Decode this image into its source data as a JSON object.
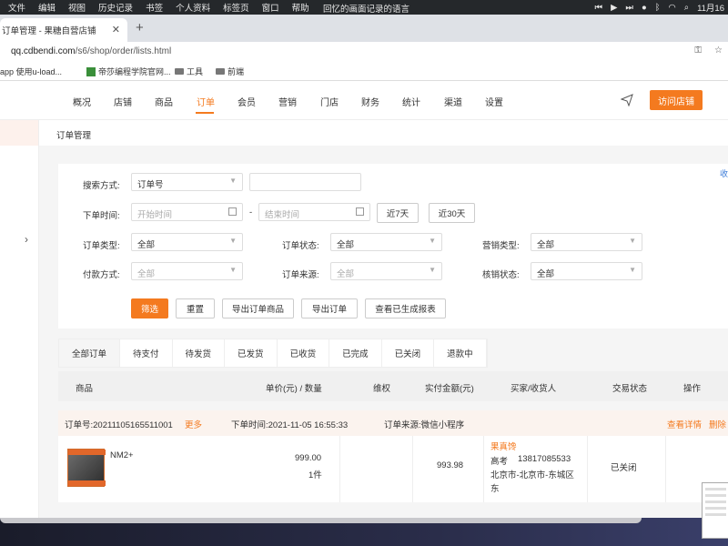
{
  "menubar": {
    "items": [
      "文件",
      "编辑",
      "视图",
      "历史记录",
      "书签",
      "个人资料",
      "标签页",
      "窗口",
      "帮助"
    ],
    "center_text": "回忆的画面记录的语言",
    "clock": "11月16"
  },
  "browser": {
    "tab_title": "订单管理 - 果糖自营店铺",
    "url_host": "qq.cdbendi.com",
    "url_path": "/s6/shop/order/lists.html",
    "bookmarks": [
      {
        "label": "app 使用u-load...",
        "icon": "app-icon"
      },
      {
        "label": "帝莎编程学院官网...",
        "icon": "site-icon"
      },
      {
        "label": "工具",
        "icon": "folder-icon"
      },
      {
        "label": "前端",
        "icon": "folder-icon"
      }
    ]
  },
  "topnav": {
    "items": [
      "概况",
      "店铺",
      "商品",
      "订单",
      "会员",
      "营销",
      "门店",
      "财务",
      "统计",
      "渠道",
      "设置"
    ],
    "active": "订单",
    "visit_button": "访问店铺"
  },
  "breadcrumb": "订单管理",
  "filters": {
    "collapse_link": "收",
    "search_label": "搜索方式:",
    "search_type": "订单号",
    "search_value": "",
    "time_label": "下单时间:",
    "start_placeholder": "开始时间",
    "end_placeholder": "结束时间",
    "dash": "-",
    "quick_7": "近7天",
    "quick_30": "近30天",
    "order_type_label": "订单类型:",
    "order_type": "全部",
    "order_status_label": "订单状态:",
    "order_status": "全部",
    "marketing_label": "营销类型:",
    "marketing": "全部",
    "pay_label": "付款方式:",
    "pay": "全部",
    "source_label": "订单来源:",
    "source": "全部",
    "verify_label": "核销状态:",
    "verify": "全部",
    "btn_filter": "筛选",
    "btn_reset": "重置",
    "btn_export_goods": "导出订单商品",
    "btn_export_orders": "导出订单",
    "btn_reports": "查看已生成报表"
  },
  "order_tabs": [
    "全部订单",
    "待支付",
    "待发货",
    "已发货",
    "已收货",
    "已完成",
    "已关闭",
    "退款中"
  ],
  "table_headers": [
    "商品",
    "单价(元) / 数量",
    "维权",
    "实付金额(元)",
    "买家/收货人",
    "交易状态",
    "操作"
  ],
  "order": {
    "order_no_label": "订单号:",
    "order_no": "20211105165511001",
    "more": "更多",
    "time_label": "下单时间:",
    "time": "2021-11-05 16:55:33",
    "source_label": "订单来源:",
    "source": "微信小程序",
    "view_detail": "查看详情",
    "delete": "删除",
    "product_name": "NM2+",
    "price": "999.00",
    "qty": "1件",
    "paid": "993.98",
    "buyer": "果真馋",
    "receiver_name": "高考",
    "receiver_phone": "13817085533",
    "address_line1": "北京市-北京市-东城区",
    "address_line2": "东",
    "status": "已关闭"
  },
  "colors": {
    "accent": "#f47a1f",
    "link": "#3b7bd8",
    "menubar": "#25282b"
  }
}
